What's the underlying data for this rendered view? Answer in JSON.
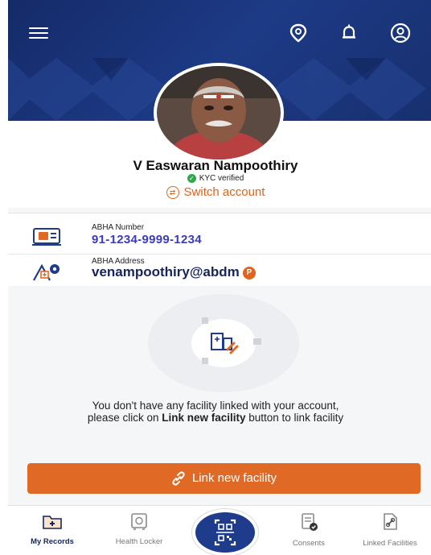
{
  "profile": {
    "name": "V Easwaran Nampoothiry",
    "kyc_status": "KYC verified",
    "switch_account_label": "Switch account"
  },
  "abha_number": {
    "label": "ABHA Number",
    "value": "91-1234-9999-1234"
  },
  "abha_address": {
    "label": "ABHA Address",
    "value": "venampoothiry@abdm",
    "badge": "P"
  },
  "empty_state": {
    "message_prefix": "You don't have any facility linked with your account,",
    "message_line2_pre": "please click on ",
    "message_bold": "Link new facility",
    "message_line2_post": " button to link facility"
  },
  "link_button_label": "Link new facility",
  "bottom_nav": {
    "my_records": "My Records",
    "health_locker": "Health Locker",
    "consents": "Consents",
    "linked_facilities": "Linked Facilities"
  },
  "colors": {
    "header": "#1d3a86",
    "accent": "#e06a25",
    "verified": "#2fa84f"
  }
}
